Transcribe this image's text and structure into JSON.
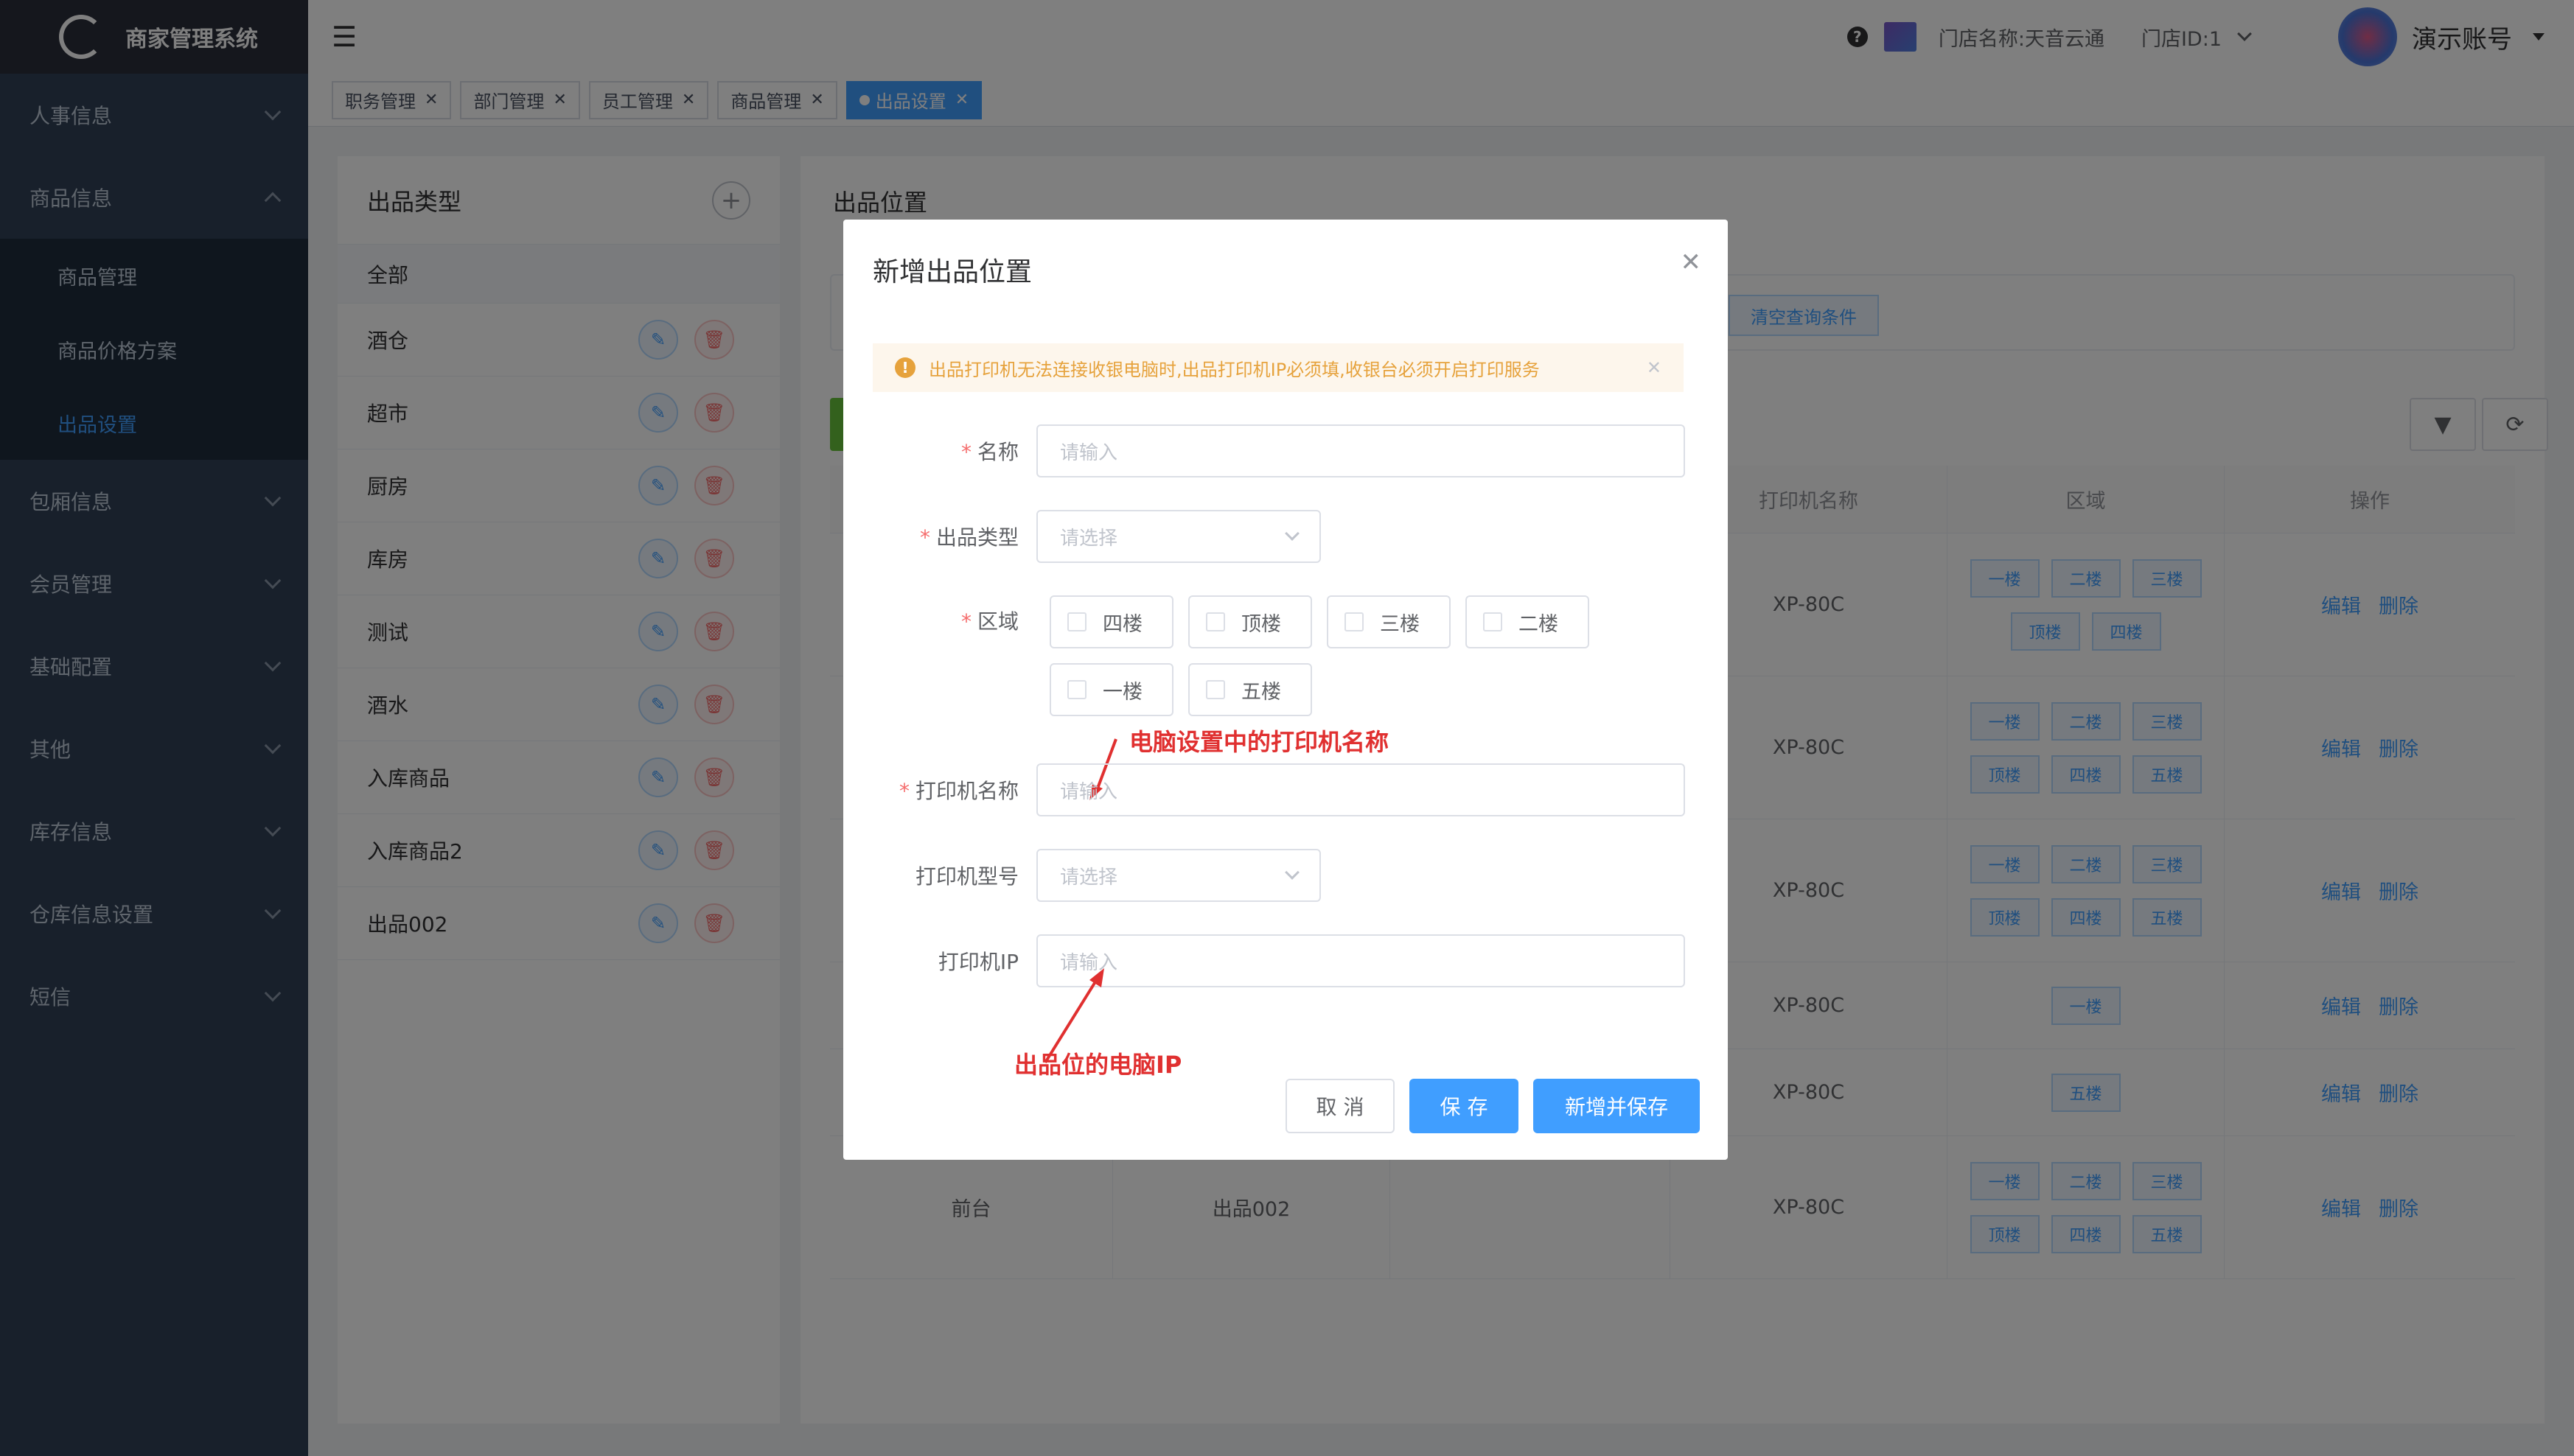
{
  "app": {
    "title": "商家管理系统"
  },
  "sidebar": {
    "groups": [
      {
        "label": "人事信息"
      },
      {
        "label": "商品信息",
        "children": [
          "商品管理",
          "商品价格方案",
          "出品设置"
        ]
      },
      {
        "label": "包厢信息"
      },
      {
        "label": "会员管理"
      },
      {
        "label": "基础配置"
      },
      {
        "label": "其他"
      },
      {
        "label": "库存信息"
      },
      {
        "label": "仓库信息设置"
      },
      {
        "label": "短信"
      }
    ]
  },
  "header": {
    "store_name": "门店名称:天音云通",
    "store_id": "门店ID:1",
    "account": "演示账号"
  },
  "tabs": [
    "职务管理",
    "部门管理",
    "员工管理",
    "商品管理",
    "出品设置"
  ],
  "left_panel": {
    "title": "出品类型",
    "categories": [
      "全部",
      "酒仓",
      "超市",
      "厨房",
      "库房",
      "测试",
      "酒水",
      "入库商品",
      "入库商品2",
      "出品002"
    ]
  },
  "right_panel": {
    "title": "出品位置",
    "clear_label": "清空查询条件",
    "columns": [
      "打印机名称",
      "区域",
      "操作"
    ],
    "rows": [
      {
        "c1": "",
        "c2": "",
        "printer": "XP-80C",
        "areas": [
          "一楼",
          "二楼",
          "三楼",
          "顶楼",
          "四楼"
        ]
      },
      {
        "c1": "",
        "c2": "",
        "printer": "XP-80C",
        "areas": [
          "一楼",
          "二楼",
          "三楼",
          "顶楼",
          "四楼",
          "五楼"
        ]
      },
      {
        "c1": "",
        "c2": "",
        "printer": "XP-80C",
        "areas": [
          "一楼",
          "二楼",
          "三楼",
          "顶楼",
          "四楼",
          "五楼"
        ]
      },
      {
        "c1": "",
        "c2": "",
        "printer": "XP-80C",
        "areas": [
          "一楼"
        ]
      },
      {
        "c1": "",
        "c2": "",
        "printer": "XP-80C",
        "areas": [
          "五楼"
        ]
      },
      {
        "c1": "前台",
        "c2": "出品002",
        "printer": "XP-80C",
        "areas": [
          "一楼",
          "二楼",
          "三楼",
          "顶楼",
          "四楼",
          "五楼"
        ]
      }
    ],
    "edit_label": "编辑",
    "delete_label": "删除"
  },
  "dialog": {
    "title": "新增出品位置",
    "alert": "出品打印机无法连接收银电脑时,出品打印机IP必须填,收银台必须开启打印服务",
    "name_label": "名称",
    "name_placeholder": "请输入",
    "type_label": "出品类型",
    "type_placeholder": "请选择",
    "area_label": "区域",
    "areas": [
      "四楼",
      "顶楼",
      "三楼",
      "二楼",
      "一楼",
      "五楼"
    ],
    "printer_name_label": "打印机名称",
    "printer_name_placeholder": "请输入",
    "printer_model_label": "打印机型号",
    "printer_model_placeholder": "请选择",
    "printer_ip_label": "打印机IP",
    "printer_ip_placeholder": "请输入",
    "cancel_label": "取 消",
    "save_label": "保 存",
    "add_save_label": "新增并保存"
  },
  "annotations": {
    "printer_name_note": "电脑设置中的打印机名称",
    "ip_note": "出品位的电脑IP"
  }
}
